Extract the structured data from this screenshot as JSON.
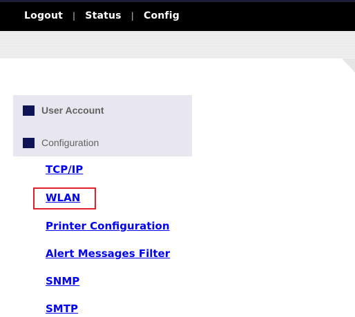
{
  "nav": {
    "items": [
      {
        "label": "Logout"
      },
      {
        "label": "Status"
      },
      {
        "label": "Config"
      }
    ],
    "separator": "|"
  },
  "sidebar": {
    "items": [
      {
        "label": "User Account"
      },
      {
        "label": "Configuration"
      }
    ]
  },
  "links": [
    {
      "label": "TCP/IP"
    },
    {
      "label": "WLAN"
    },
    {
      "label": "Printer Configuration"
    },
    {
      "label": "Alert Messages Filter"
    },
    {
      "label": "SNMP"
    },
    {
      "label": "SMTP"
    }
  ],
  "colors": {
    "topbar": "#000000",
    "link": "#0000ee",
    "sidebar_bg": "#e8e6ef",
    "bullet": "#0f1457",
    "highlight": "#e01f26"
  }
}
